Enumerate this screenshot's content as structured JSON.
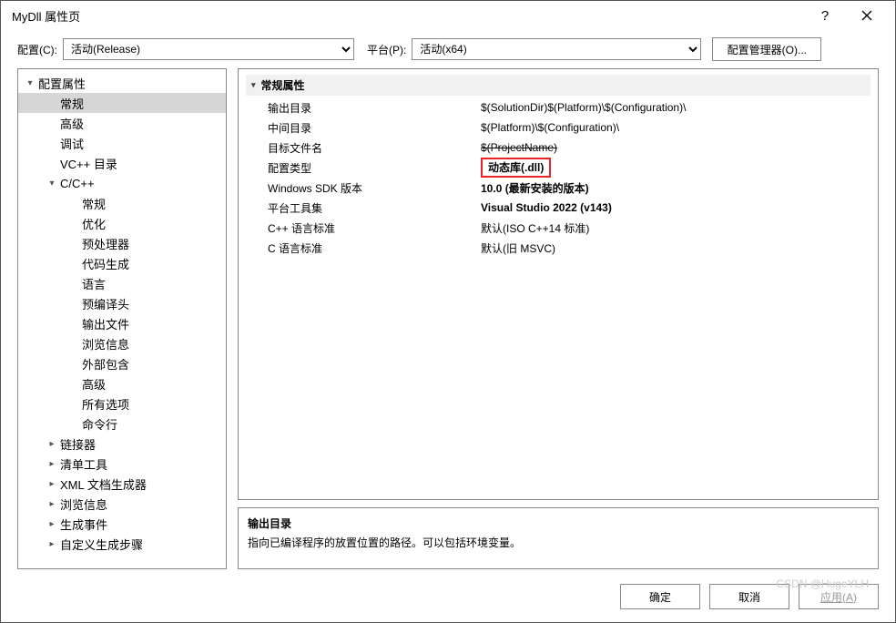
{
  "window": {
    "title": "MyDll 属性页",
    "help": "?",
    "close": "✕"
  },
  "topbar": {
    "config_label": "配置(C):",
    "config_value": "活动(Release)",
    "platform_label": "平台(P):",
    "platform_value": "活动(x64)",
    "manager_label": "配置管理器(O)..."
  },
  "tree": [
    {
      "level": 0,
      "toggle": "▾",
      "label": "配置属性",
      "selected": false
    },
    {
      "level": 1,
      "toggle": "",
      "label": "常规",
      "selected": true
    },
    {
      "level": 1,
      "toggle": "",
      "label": "高级",
      "selected": false
    },
    {
      "level": 1,
      "toggle": "",
      "label": "调试",
      "selected": false
    },
    {
      "level": 1,
      "toggle": "",
      "label": "VC++ 目录",
      "selected": false
    },
    {
      "level": 1,
      "toggle": "▾",
      "label": "C/C++",
      "selected": false
    },
    {
      "level": 2,
      "toggle": "",
      "label": "常规",
      "selected": false
    },
    {
      "level": 2,
      "toggle": "",
      "label": "优化",
      "selected": false
    },
    {
      "level": 2,
      "toggle": "",
      "label": "预处理器",
      "selected": false
    },
    {
      "level": 2,
      "toggle": "",
      "label": "代码生成",
      "selected": false
    },
    {
      "level": 2,
      "toggle": "",
      "label": "语言",
      "selected": false
    },
    {
      "level": 2,
      "toggle": "",
      "label": "预编译头",
      "selected": false
    },
    {
      "level": 2,
      "toggle": "",
      "label": "输出文件",
      "selected": false
    },
    {
      "level": 2,
      "toggle": "",
      "label": "浏览信息",
      "selected": false
    },
    {
      "level": 2,
      "toggle": "",
      "label": "外部包含",
      "selected": false
    },
    {
      "level": 2,
      "toggle": "",
      "label": "高级",
      "selected": false
    },
    {
      "level": 2,
      "toggle": "",
      "label": "所有选项",
      "selected": false
    },
    {
      "level": 2,
      "toggle": "",
      "label": "命令行",
      "selected": false
    },
    {
      "level": 1,
      "toggle": "▸",
      "label": "链接器",
      "selected": false
    },
    {
      "level": 1,
      "toggle": "▸",
      "label": "清单工具",
      "selected": false
    },
    {
      "level": 1,
      "toggle": "▸",
      "label": "XML 文档生成器",
      "selected": false
    },
    {
      "level": 1,
      "toggle": "▸",
      "label": "浏览信息",
      "selected": false
    },
    {
      "level": 1,
      "toggle": "▸",
      "label": "生成事件",
      "selected": false
    },
    {
      "level": 1,
      "toggle": "▸",
      "label": "自定义生成步骤",
      "selected": false
    }
  ],
  "grid": {
    "header": "常规属性",
    "rows": [
      {
        "k": "输出目录",
        "v": "$(SolutionDir)$(Platform)\\$(Configuration)\\",
        "bold": false,
        "strike": false,
        "boxed": false
      },
      {
        "k": "中间目录",
        "v": "$(Platform)\\$(Configuration)\\",
        "bold": false,
        "strike": false,
        "boxed": false
      },
      {
        "k": "目标文件名",
        "v": "$(ProjectName)",
        "bold": false,
        "strike": true,
        "boxed": false
      },
      {
        "k": "配置类型",
        "v": "动态库(.dll)",
        "bold": true,
        "strike": false,
        "boxed": true
      },
      {
        "k": "Windows SDK 版本",
        "v": "10.0 (最新安装的版本)",
        "bold": true,
        "strike": false,
        "boxed": false
      },
      {
        "k": "平台工具集",
        "v": "Visual Studio 2022 (v143)",
        "bold": true,
        "strike": false,
        "boxed": false
      },
      {
        "k": "C++ 语言标准",
        "v": "默认(ISO C++14 标准)",
        "bold": false,
        "strike": false,
        "boxed": false
      },
      {
        "k": "C 语言标准",
        "v": "默认(旧 MSVC)",
        "bold": false,
        "strike": false,
        "boxed": false
      }
    ]
  },
  "desc": {
    "title": "输出目录",
    "text": "指向已编译程序的放置位置的路径。可以包括环境变量。"
  },
  "footer": {
    "ok": "确定",
    "cancel": "取消",
    "apply": "应用(A)"
  },
  "watermark": "CSDN @HugeYLH"
}
